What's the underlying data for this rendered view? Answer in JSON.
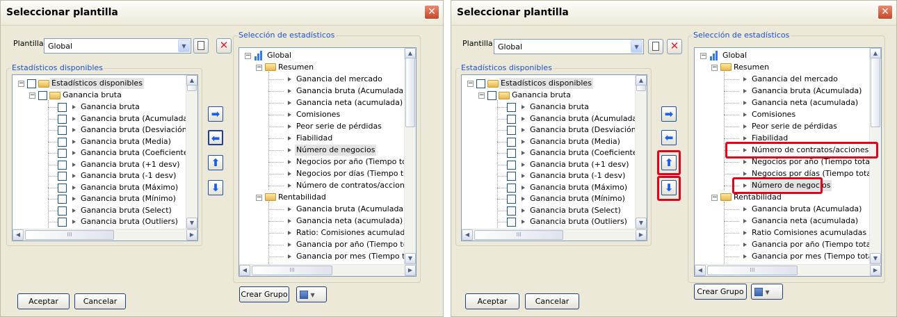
{
  "title": "Seleccionar plantilla",
  "close_symbol": "✕",
  "plantilla_label": "Plantilla",
  "plantilla_value": "Global",
  "available_caption": "Estadísticos disponibles",
  "selection_caption": "Selección de estadísticos",
  "left_tree": {
    "root": "Estadísticos disponibles",
    "group": "Ganancia bruta",
    "items": [
      "Ganancia bruta",
      "Ganancia bruta (Acumulada)",
      "Ganancia bruta (Desviación ti",
      "Ganancia bruta (Media)",
      "Ganancia bruta (Coeficiente c",
      "Ganancia bruta (+1 desv)",
      "Ganancia bruta (-1 desv)",
      "Ganancia bruta (Máximo)",
      "Ganancia bruta (Mínimo)",
      "Ganancia bruta (Select)",
      "Ganancia bruta (Outliers)"
    ]
  },
  "right_tree_1": {
    "root": "Global",
    "resumen": "Resumen",
    "resumen_items": [
      "Ganancia del mercado",
      "Ganancia bruta (Acumulada)",
      "Ganancia neta (acumulada)",
      "Comisiones",
      "Peor serie de pérdidas",
      "Fiabilidad",
      "Número de negocios",
      "Negocios por año (Tiempo total)",
      "Negocios por días (Tiempo total)",
      "Número de contratos/acciones (M"
    ],
    "rentabilidad": "Rentabilidad",
    "rentabilidad_items": [
      "Ganancia bruta (Acumulada)",
      "Ganancia neta (acumulada)",
      "Ratio: Comisiones acumuladas / G",
      "Ganancia por año (Tiempo total)",
      "Ganancia por mes (Tiempo total)"
    ]
  },
  "right_tree_2": {
    "root": "Global",
    "resumen": "Resumen",
    "resumen_items": [
      "Ganancia del mercado",
      "Ganancia bruta (Acumulada)",
      "Ganancia neta (acumulada)",
      "Comisiones",
      "Peor serie de pérdidas",
      "Fiabilidad",
      "Número de contratos/acciones (Máx",
      "Negocios por año (Tiempo total)",
      "Negocios por días (Tiempo total)",
      "Número de negocios"
    ],
    "rentabilidad": "Rentabilidad",
    "rentabilidad_items": [
      "Ganancia bruta (Acumulada)",
      "Ganancia neta (acumulada)",
      "Ratio  Comisiones acumuladas / Gan",
      "Ganancia por año (Tiempo total)",
      "Ganancia por mes (Tiempo total)"
    ]
  },
  "buttons": {
    "crear_grupo": "Crear Grupo",
    "aceptar": "Aceptar",
    "cancelar": "Cancelar"
  },
  "scroll_h_mark": "III",
  "accent": "#1d5fe3",
  "highlight": "#e3001b"
}
